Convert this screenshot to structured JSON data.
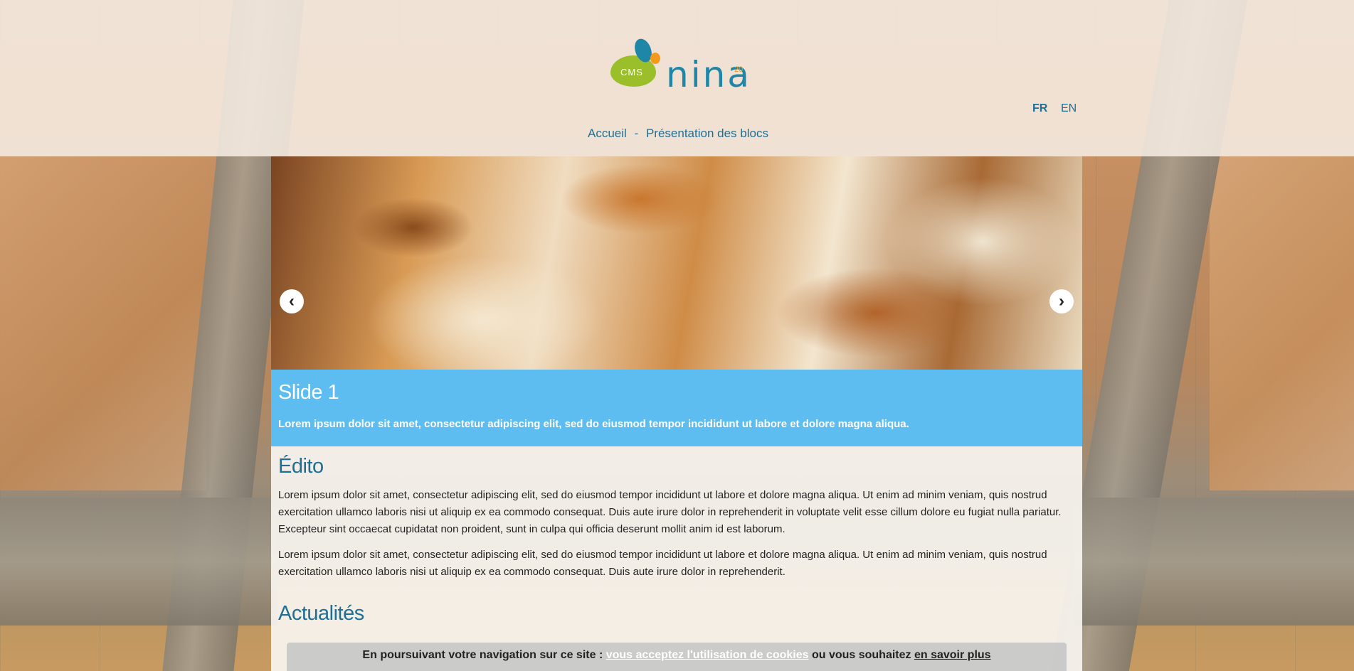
{
  "header": {
    "logo": {
      "badge": "CMS",
      "wordmark": "nina",
      "superscript": "20"
    },
    "languages": [
      {
        "code": "FR",
        "active": true
      },
      {
        "code": "EN",
        "active": false
      }
    ],
    "breadcrumb": [
      {
        "label": "Accueil"
      },
      {
        "label": "-"
      },
      {
        "label": "Présentation des blocs"
      }
    ]
  },
  "slider": {
    "prev_icon": "chevron-left-icon",
    "next_icon": "chevron-right-icon",
    "slide": {
      "title": "Slide 1",
      "text": "Lorem ipsum dolor sit amet, consectetur adipiscing elit, sed do eiusmod tempor incididunt ut labore et dolore magna aliqua."
    }
  },
  "content": {
    "edito_title": "Édito",
    "paragraph_1": "Lorem ipsum dolor sit amet, consectetur adipiscing elit, sed do eiusmod tempor incididunt ut labore et dolore magna aliqua. Ut enim ad minim veniam, quis nostrud exercitation ullamco laboris nisi ut aliquip ex ea commodo consequat. Duis aute irure dolor in reprehenderit in voluptate velit esse cillum dolore eu fugiat nulla pariatur. Excepteur sint occaecat cupidatat non proident, sunt in culpa qui officia deserunt mollit anim id est laborum.",
    "paragraph_2": "Lorem ipsum dolor sit amet, consectetur adipiscing elit, sed do eiusmod tempor incididunt ut labore et dolore magna aliqua. Ut enim ad minim veniam, quis nostrud exercitation ullamco laboris nisi ut aliquip ex ea commodo consequat. Duis aute irure dolor in reprehenderit.",
    "news_title": "Actualités"
  },
  "cookie_banner": {
    "prefix": "En poursuivant votre navigation sur ce site : ",
    "accept_link": "vous acceptez l'utilisation de cookies",
    "middle": " ou vous souhaitez ",
    "more_link": "en savoir plus"
  },
  "colors": {
    "brand_blue": "#1f86a8",
    "link_blue": "#1f6f95",
    "caption_blue": "#5ebdf0",
    "logo_green": "#9bbf2a",
    "logo_orange": "#f39a1e"
  }
}
